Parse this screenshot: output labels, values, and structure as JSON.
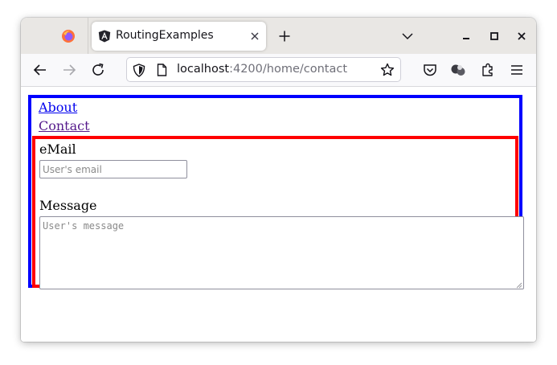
{
  "browser": {
    "tab": {
      "title": "RoutingExamples"
    },
    "url": {
      "host": "localhost",
      "path": ":4200/home/contact"
    },
    "icons": {
      "firefox_view": "firefox-icon",
      "tab_favicon": "angular-icon",
      "tab_close": "close-icon",
      "new_tab": "plus-icon",
      "list_tabs": "chevron-down-icon",
      "minimize": "minimize-icon",
      "maximize": "maximize-icon",
      "close_window": "close-icon",
      "back": "back-arrow-icon",
      "forward": "forward-arrow-icon",
      "reload": "reload-icon",
      "tracking_protection": "shield-icon",
      "page_info": "page-icon",
      "bookmark": "star-icon",
      "pocket": "pocket-icon",
      "extension": "extension-icon",
      "puzzle": "puzzle-icon",
      "menu": "hamburger-icon"
    }
  },
  "page": {
    "nav": {
      "about": "About",
      "contact": "Contact"
    },
    "form": {
      "email_label": "eMail",
      "email_placeholder": "User's email",
      "email_value": "",
      "message_label": "Message",
      "message_placeholder": "User's message",
      "message_value": ""
    }
  },
  "colors": {
    "outer_border": "#0000ff",
    "inner_border": "#ff0000",
    "link": "#0000ee",
    "link_visited": "#551a8b"
  }
}
